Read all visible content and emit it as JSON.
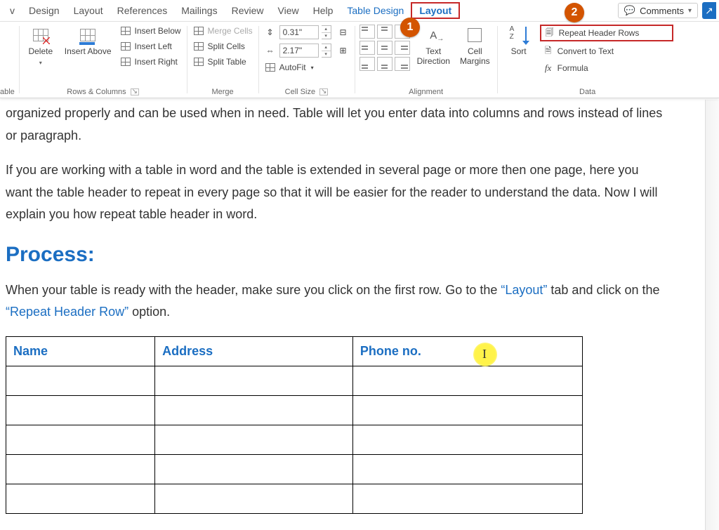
{
  "tabs": {
    "items": [
      "v",
      "Design",
      "Layout",
      "References",
      "Mailings",
      "Review",
      "View",
      "Help"
    ],
    "table_design": "Table Design",
    "layout": "Layout",
    "comments": "Comments"
  },
  "ribbon": {
    "table": {
      "label": "able"
    },
    "delete": {
      "label": "Delete"
    },
    "insert_above": {
      "label": "Insert Above"
    },
    "insert_below": "Insert Below",
    "insert_left": "Insert Left",
    "insert_right": "Insert Right",
    "rows_cols_label": "Rows & Columns",
    "merge_cells": "Merge Cells",
    "split_cells": "Split Cells",
    "split_table": "Split Table",
    "merge_label": "Merge",
    "height_value": "0.31\"",
    "width_value": "2.17\"",
    "autofit": "AutoFit",
    "cell_size_label": "Cell Size",
    "text_direction": {
      "line1": "Text",
      "line2": "Direction"
    },
    "cell_margins": {
      "line1": "Cell",
      "line2": "Margins"
    },
    "alignment_label": "Alignment",
    "sort": "Sort",
    "repeat_header": "Repeat Header Rows",
    "convert_text": "Convert to Text",
    "formula": "Formula",
    "data_label": "Data"
  },
  "document": {
    "p1": "organized properly and can be used when in need. Table will let you enter data into columns and rows instead of lines or paragraph.",
    "p2a": "If you are working with a table in word and the table is extended in several page or more then one page, here you want the table header to repeat in every page so that it will be easier for the reader to understand the data.  Now I will explain you how ",
    "p2b": "repeat table header in word",
    "p2c": ".",
    "heading": "Process:",
    "p3a": "When your table is ready with the header, make sure you click on the first row. Go to the ",
    "p3_link1": "“Layout”",
    "p3b": " tab and click on the ",
    "p3_link2": "“Repeat Header Row”",
    "p3c": " option.",
    "table_headers": [
      "Name",
      "Address",
      "Phone no."
    ]
  },
  "badges": {
    "one": "1",
    "two": "2"
  }
}
